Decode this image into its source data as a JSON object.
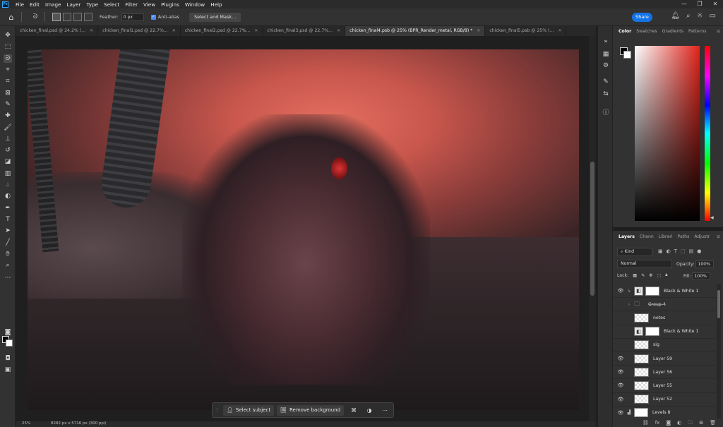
{
  "menubar": {
    "logo": "Ps",
    "items": [
      "File",
      "Edit",
      "Image",
      "Layer",
      "Type",
      "Select",
      "Filter",
      "View",
      "Plugins",
      "Window",
      "Help"
    ],
    "window_controls": [
      "—",
      "❐",
      "✕"
    ]
  },
  "options": {
    "feather_label": "Feather:",
    "feather_value": "0 px",
    "antialias_label": "Anti-alias",
    "select_mask_label": "Select and Mask...",
    "share_label": "Share"
  },
  "tabs": [
    {
      "label": "chicken_final.psd @ 24.2% (..."
    },
    {
      "label": "chicken_final1.psd @ 22.7%..."
    },
    {
      "label": "chicken_final2.psd @ 22.7%..."
    },
    {
      "label": "chicken_final3.psd @ 22.7%..."
    },
    {
      "label": "chicken_final4.psb @ 25% (BPR_Render_metal, RGB/8) *"
    },
    {
      "label": "chicken_final5.psb @ 25% (..."
    }
  ],
  "context_bar": {
    "select_subject": "Select subject",
    "remove_background": "Remove background"
  },
  "status": {
    "zoom": "25%",
    "dimensions": "8282 px x 5716 px (300 ppi)"
  },
  "color_panel": {
    "tabs": [
      "Color",
      "Swatches",
      "Gradients",
      "Patterns"
    ],
    "active_tab": "Color",
    "accent": "#e0241b"
  },
  "layers_panel": {
    "tabs": [
      "Layers",
      "Chann",
      "Librari",
      "Paths",
      "Adjustr"
    ],
    "kind_label": "Kind",
    "blend_mode": "Normal",
    "opacity_label": "Opacity:",
    "opacity_value": "100%",
    "lock_label": "Lock:",
    "fill_label": "Fill:",
    "fill_value": "100%",
    "layers": [
      {
        "name": "Black & White 1",
        "visible": true,
        "type": "adjustment"
      },
      {
        "name": "Group 4",
        "visible": false,
        "type": "group"
      },
      {
        "name": "notes",
        "visible": false,
        "type": "pixel"
      },
      {
        "name": "Black & White 1",
        "visible": false,
        "type": "adjustment"
      },
      {
        "name": "sig",
        "visible": false,
        "type": "pixel"
      },
      {
        "name": "Layer 59",
        "visible": true,
        "type": "pixel"
      },
      {
        "name": "Layer 56",
        "visible": true,
        "type": "pixel"
      },
      {
        "name": "Layer 55",
        "visible": true,
        "type": "pixel"
      },
      {
        "name": "Layer 52",
        "visible": true,
        "type": "pixel"
      },
      {
        "name": "Levels 8",
        "visible": true,
        "type": "adjustment"
      }
    ]
  }
}
